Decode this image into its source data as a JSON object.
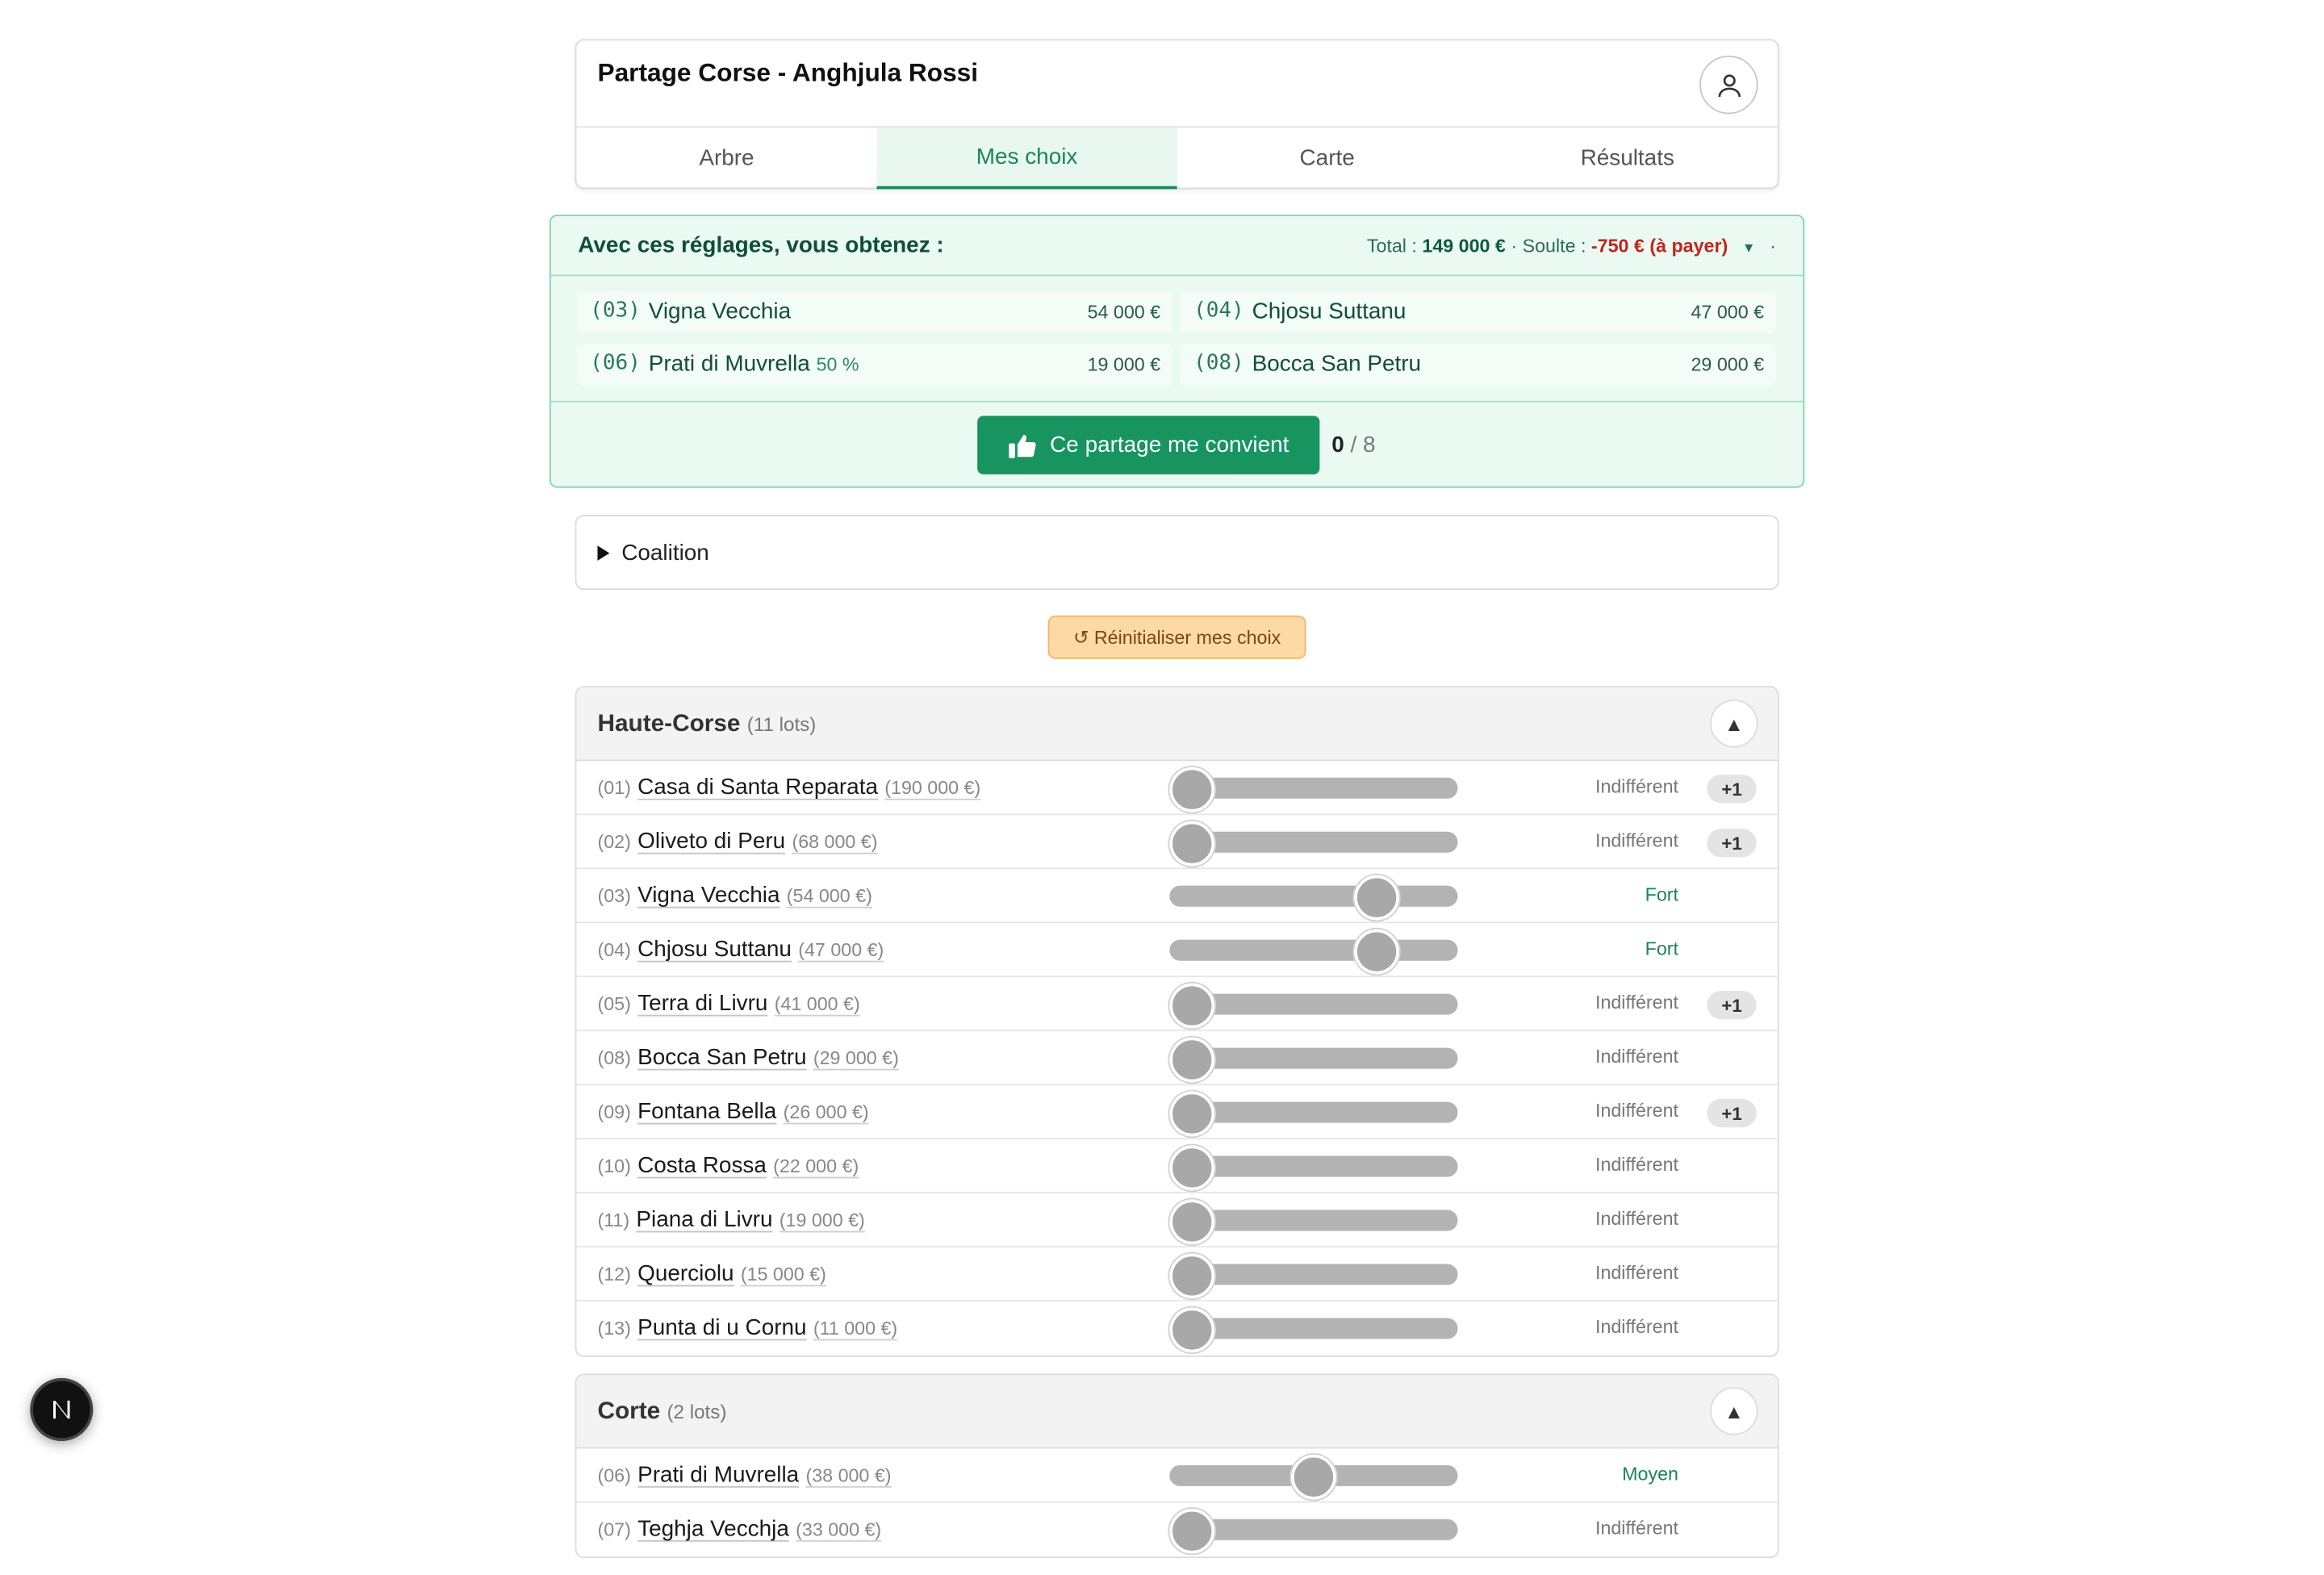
{
  "header": {
    "title": "Partage Corse - Anghjula Rossi",
    "tabs": [
      {
        "label": "Arbre",
        "active": false
      },
      {
        "label": "Mes choix",
        "active": true
      },
      {
        "label": "Carte",
        "active": false
      },
      {
        "label": "Résultats",
        "active": false
      }
    ]
  },
  "summary": {
    "title": "Avec ces réglages, vous obtenez :",
    "total_label": "Total :",
    "total_value": "149 000 €",
    "sep": "·",
    "soulte_label": "Soulte :",
    "soulte_value": "-750 € (à payer)",
    "lots": [
      {
        "num": "(03)",
        "name": "Vigna Vecchia",
        "pct": "",
        "price": "54 000 €"
      },
      {
        "num": "(04)",
        "name": "Chjosu Suttanu",
        "pct": "",
        "price": "47 000 €"
      },
      {
        "num": "(06)",
        "name": "Prati di Muvrella",
        "pct": "50 %",
        "price": "19 000 €"
      },
      {
        "num": "(08)",
        "name": "Bocca San Petru",
        "pct": "",
        "price": "29 000 €"
      }
    ],
    "accept_label": "Ce partage me convient",
    "accept_count": "0",
    "accept_total": "/ 8"
  },
  "coalition": {
    "label": "Coalition"
  },
  "reset": {
    "label": "↺ Réinitialiser mes choix"
  },
  "groups": [
    {
      "name": "Haute-Corse",
      "count": "(11 lots)",
      "lots": [
        {
          "num": "(01)",
          "name": "Casa di Santa Reparata",
          "price": "(190 000 €)",
          "level": 0,
          "pref": "Indifférent",
          "badge": "+1"
        },
        {
          "num": "(02)",
          "name": "Oliveto di Peru",
          "price": "(68 000 €)",
          "level": 0,
          "pref": "Indifférent",
          "badge": "+1"
        },
        {
          "num": "(03)",
          "name": "Vigna Vecchia",
          "price": "(54 000 €)",
          "level": 0.76,
          "pref": "Fort",
          "badge": ""
        },
        {
          "num": "(04)",
          "name": "Chjosu Suttanu",
          "price": "(47 000 €)",
          "level": 0.76,
          "pref": "Fort",
          "badge": ""
        },
        {
          "num": "(05)",
          "name": "Terra di Livru",
          "price": "(41 000 €)",
          "level": 0,
          "pref": "Indifférent",
          "badge": "+1"
        },
        {
          "num": "(08)",
          "name": "Bocca San Petru",
          "price": "(29 000 €)",
          "level": 0,
          "pref": "Indifférent",
          "badge": ""
        },
        {
          "num": "(09)",
          "name": "Fontana Bella",
          "price": "(26 000 €)",
          "level": 0,
          "pref": "Indifférent",
          "badge": "+1"
        },
        {
          "num": "(10)",
          "name": "Costa Rossa",
          "price": "(22 000 €)",
          "level": 0,
          "pref": "Indifférent",
          "badge": ""
        },
        {
          "num": "(11)",
          "name": "Piana di Livru",
          "price": "(19 000 €)",
          "level": 0,
          "pref": "Indifférent",
          "badge": ""
        },
        {
          "num": "(12)",
          "name": "Querciolu",
          "price": "(15 000 €)",
          "level": 0,
          "pref": "Indifférent",
          "badge": ""
        },
        {
          "num": "(13)",
          "name": "Punta di u Cornu",
          "price": "(11 000 €)",
          "level": 0,
          "pref": "Indifférent",
          "badge": ""
        }
      ]
    },
    {
      "name": "Corte",
      "count": "(2 lots)",
      "lots": [
        {
          "num": "(06)",
          "name": "Prati di Muvrella",
          "price": "(38 000 €)",
          "level": 0.5,
          "pref": "Moyen",
          "badge": ""
        },
        {
          "num": "(07)",
          "name": "Teghja Vecchja",
          "price": "(33 000 €)",
          "level": 0,
          "pref": "Indifférent",
          "badge": ""
        }
      ]
    }
  ],
  "colors": {
    "accent": "#17875a",
    "soulte": "#c0261e",
    "reset_bg": "#fdd9a5"
  },
  "icons": {
    "avatar": "user-icon",
    "accept": "thumbs-up-icon",
    "collapse": "triangle-up-icon",
    "floating": "next-logo-icon"
  }
}
